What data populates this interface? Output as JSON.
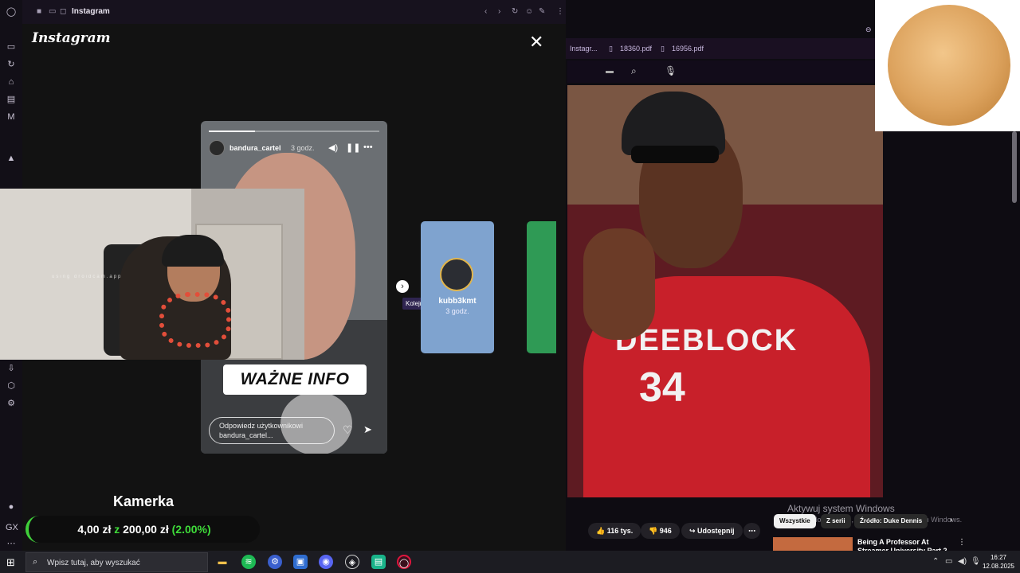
{
  "popup": {
    "title": "Instagram"
  },
  "instagram": {
    "logo": "Instagram",
    "story": {
      "username": "bandura_cartel",
      "time": "3 godz.",
      "banner": "WAŻNE INFO",
      "reply_placeholder": "Odpowiedz użytkownikowi bandura_cartel..."
    },
    "next_tooltip": "Kolejna",
    "next_story": {
      "username": "kubb3kmt",
      "time": "3 godz."
    }
  },
  "overlay": {
    "camera_label": "Kamerka",
    "donation_current": "4,00 zł",
    "donation_sep": "z",
    "donation_goal": "200,00 zł",
    "donation_pct": "(2.00%)",
    "webcam_watermark": "using droidcam.app"
  },
  "browser_tabs": [
    {
      "label": "Instagr..."
    },
    {
      "label": "18360.pdf"
    },
    {
      "label": "16956.pdf"
    }
  ],
  "video": {
    "jersey_text": "DEEBLOCK",
    "jersey_number": "34",
    "likes": "116 tys.",
    "comments": "946",
    "share": "Udostępnij",
    "chips": [
      "Wszystkie",
      "Z serii",
      "Źródło: Duke Dennis"
    ],
    "recommended_title": "Being A Professor At Streamer University Part 2"
  },
  "windows": {
    "activate_title": "Aktywuj system Windows",
    "activate_sub": "Przejdź do ustawień, aby aktywować system Windows.",
    "search_placeholder": "Wpisz tutaj, aby wyszukać",
    "time": "16:27",
    "date": "12.08.2025"
  },
  "colors": {
    "accent_green": "#3fdc3a",
    "tooltip": "#2f2450",
    "jersey": "#c8202a"
  }
}
